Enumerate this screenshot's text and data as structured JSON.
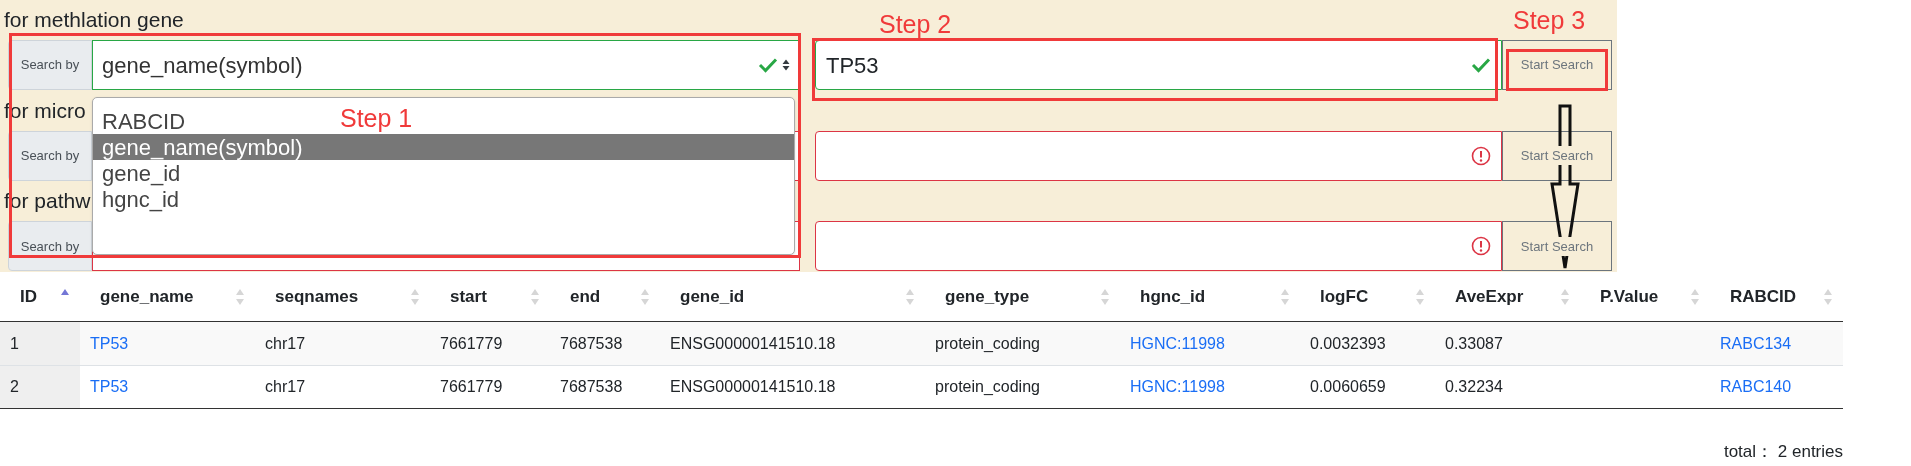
{
  "sections": [
    {
      "label": "for methlation gene",
      "search_by": "Search by",
      "select": {
        "value": "gene_name(symbol)",
        "valid": true
      },
      "input": {
        "value": "TP53",
        "valid": true
      },
      "button": "Start Search"
    },
    {
      "label": "for micro",
      "search_by": "Search by",
      "input": {
        "valid": false
      },
      "button": "Start Search"
    },
    {
      "label": "for pathw",
      "search_by": "Search by",
      "input": {
        "valid": false
      },
      "button": "Start Search"
    }
  ],
  "dropdown": {
    "options": [
      {
        "label": "RABCID",
        "selected": false
      },
      {
        "label": "gene_name(symbol)",
        "selected": true
      },
      {
        "label": "gene_id",
        "selected": false
      },
      {
        "label": "hgnc_id",
        "selected": false
      }
    ]
  },
  "annotations": [
    {
      "label": "Step 1"
    },
    {
      "label": "Step 2"
    },
    {
      "label": "Step 3"
    }
  ],
  "table": {
    "columns": [
      {
        "label": "ID",
        "sorted": true
      },
      {
        "label": "gene_name",
        "sorted": false
      },
      {
        "label": "seqnames",
        "sorted": false
      },
      {
        "label": "start",
        "sorted": false
      },
      {
        "label": "end",
        "sorted": false
      },
      {
        "label": "gene_id",
        "sorted": false
      },
      {
        "label": "gene_type",
        "sorted": false
      },
      {
        "label": "hgnc_id",
        "sorted": false
      },
      {
        "label": "logFC",
        "sorted": false
      },
      {
        "label": "AveExpr",
        "sorted": false
      },
      {
        "label": "P.Value",
        "sorted": false
      },
      {
        "label": "RABCID",
        "sorted": false
      }
    ],
    "rows": [
      {
        "cells": [
          {
            "text": "1",
            "link": false
          },
          {
            "text": "TP53",
            "link": true
          },
          {
            "text": "chr17",
            "link": false
          },
          {
            "text": "7661779",
            "link": false
          },
          {
            "text": "7687538",
            "link": false
          },
          {
            "text": "ENSG00000141510.18",
            "link": false
          },
          {
            "text": "protein_coding",
            "link": false
          },
          {
            "text": "HGNC:11998",
            "link": true
          },
          {
            "text": "0.0032393",
            "link": false
          },
          {
            "text": "0.33087",
            "link": false
          },
          null,
          {
            "text": "RABC134",
            "link": true
          }
        ]
      },
      {
        "cells": [
          {
            "text": "2",
            "link": false
          },
          {
            "text": "TP53",
            "link": true
          },
          {
            "text": "chr17",
            "link": false
          },
          {
            "text": "7661779",
            "link": false
          },
          {
            "text": "7687538",
            "link": false
          },
          {
            "text": "ENSG00000141510.18",
            "link": false
          },
          {
            "text": "protein_coding",
            "link": false
          },
          {
            "text": "HGNC:11998",
            "link": true
          },
          {
            "text": "0.0060659",
            "link": false
          },
          {
            "text": "0.32234",
            "link": false
          },
          null,
          {
            "text": "RABC140",
            "link": true
          }
        ]
      }
    ],
    "footer": "total： 2 entries"
  }
}
